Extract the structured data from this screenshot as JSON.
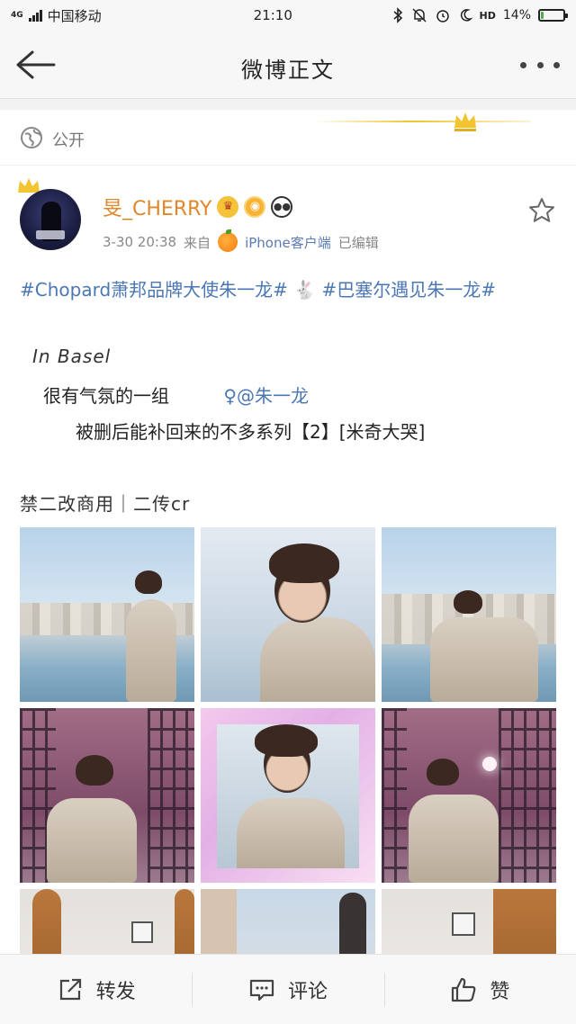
{
  "status_bar": {
    "network": "4G",
    "carrier": "中国移动",
    "time": "21:10",
    "battery_text": "14%",
    "battery_level": 0.14,
    "icons": [
      "bluetooth-icon",
      "bell-off-icon",
      "alarm-icon",
      "moon-icon",
      "hd-call-icon",
      "battery-icon"
    ],
    "hd_label": "HD"
  },
  "nav": {
    "title": "微博正文",
    "back_icon": "arrow-left-icon",
    "more_icon": "more-dots-icon"
  },
  "visibility": {
    "icon": "globe-icon",
    "label": "公开"
  },
  "author": {
    "name": "旻_CHERRY",
    "badges": [
      "crown-badge",
      "ring-badge",
      "panda-badge"
    ],
    "date": "3-30 20:38",
    "from_label": "来自",
    "source": "iPhone客户端",
    "edited": "已编辑",
    "favorite_icon": "star-icon"
  },
  "post": {
    "hashtag1": "#Chopard萧邦品牌大使朱一龙#",
    "hashtag2": "#巴塞尔遇见朱一龙#",
    "line_basel": "In Basel",
    "line_quote": "很有气氛的一组",
    "mention": "♀@朱一龙",
    "line_repost": "被删后能补回来的不多系列【2】[米奇大哭]",
    "line_notice": "禁二改商用｜二传cr"
  },
  "photos": [
    {
      "name": "photo-1",
      "scene": "riverside"
    },
    {
      "name": "photo-2",
      "scene": "portrait-closeup"
    },
    {
      "name": "photo-3",
      "scene": "riverside-cathedral"
    },
    {
      "name": "photo-4",
      "scene": "gate-pink"
    },
    {
      "name": "photo-5",
      "scene": "pink-frame"
    },
    {
      "name": "photo-6",
      "scene": "gate-watch"
    },
    {
      "name": "photo-7",
      "scene": "door"
    },
    {
      "name": "photo-8",
      "scene": "statue"
    },
    {
      "name": "photo-9",
      "scene": "wall-door"
    }
  ],
  "actions": {
    "repost": {
      "label": "转发",
      "icon": "share-icon"
    },
    "comment": {
      "label": "评论",
      "icon": "comment-icon"
    },
    "like": {
      "label": "赞",
      "icon": "thumbs-up-icon"
    }
  },
  "colors": {
    "accent_link": "#4b77b5",
    "username": "#e0872b",
    "crown_gold": "#f2c431"
  }
}
